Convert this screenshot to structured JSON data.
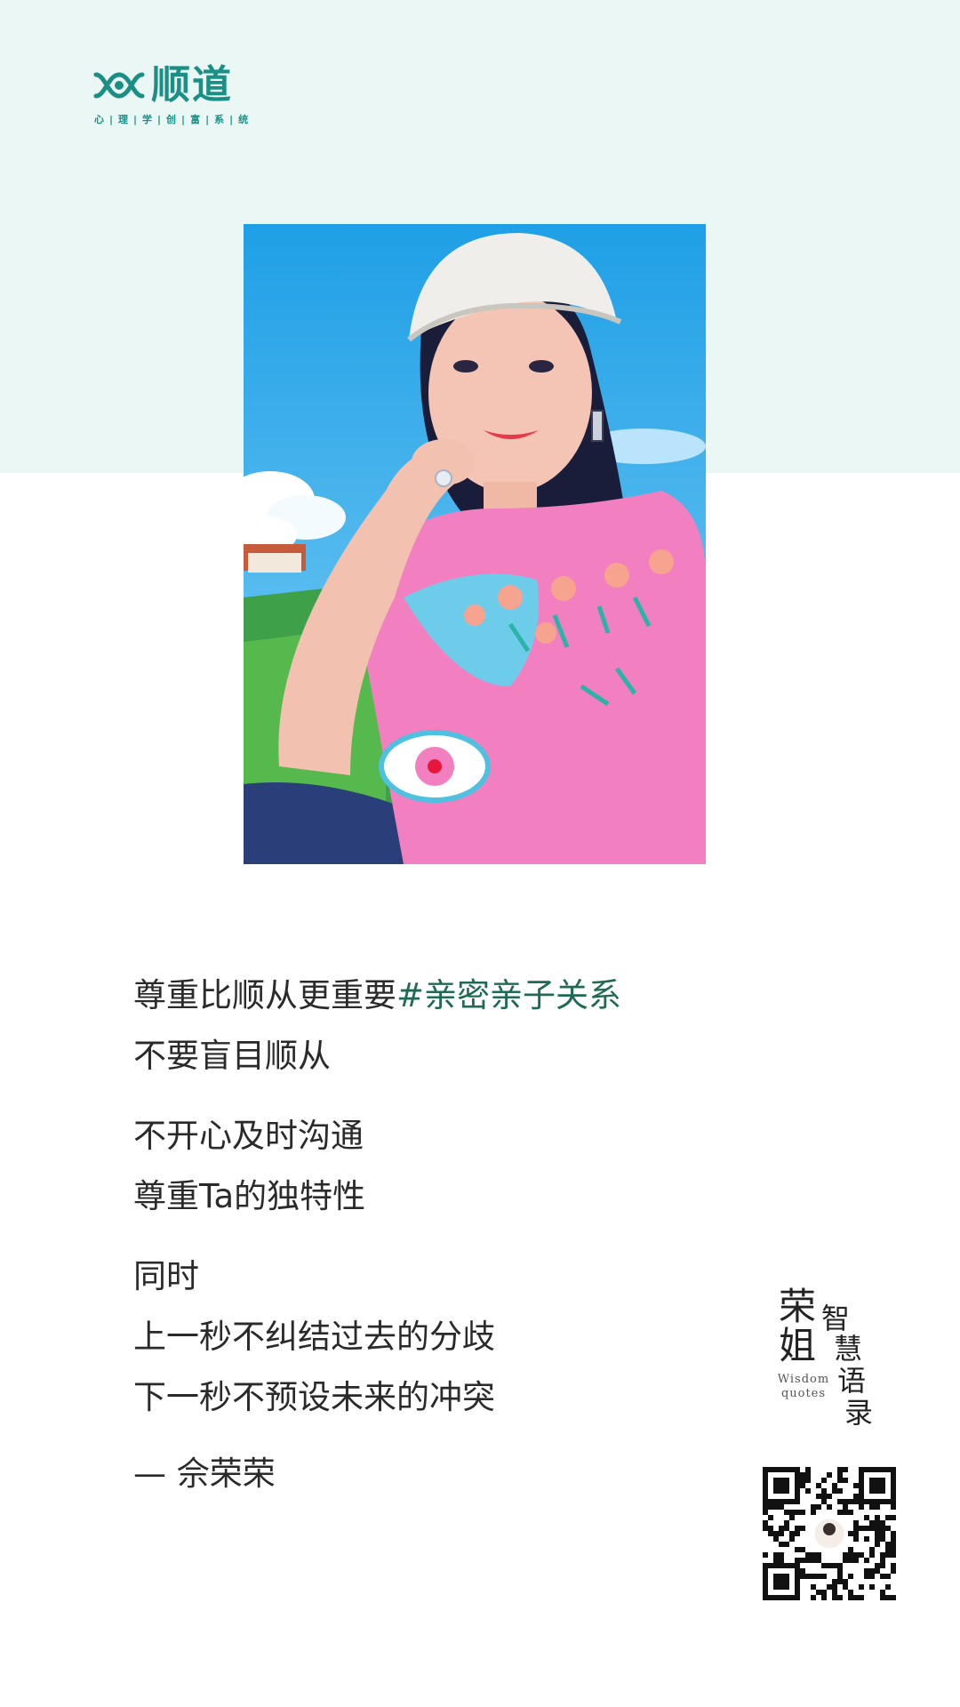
{
  "brand": {
    "name": "顺道",
    "tagline": "心|理|学|创|富|系|统",
    "color": "#1a8f86"
  },
  "colors": {
    "top_band": "#eaf7f4",
    "hashtag": "#1f6a55",
    "text": "#2a2a2a"
  },
  "quote": {
    "lead": "尊重比顺从更重要",
    "hashtag": "#亲密亲子关系",
    "line2": "不要盲目顺从",
    "line3": "不开心及时沟通",
    "line4": "尊重Ta的独特性",
    "line5": "同时",
    "line6": "上一秒不纠结过去的分歧",
    "line7": "下一秒不预设未来的冲突",
    "author": "— 佘荣荣"
  },
  "stamp": {
    "big_1": "荣",
    "big_2": "姐",
    "small_1": "智",
    "small_2": "慧",
    "small_3": "语",
    "small_4": "录",
    "en_1": "Wisdom",
    "en_2": "quotes"
  },
  "icons": [
    "brand-logo-icon",
    "qr-code-icon"
  ]
}
